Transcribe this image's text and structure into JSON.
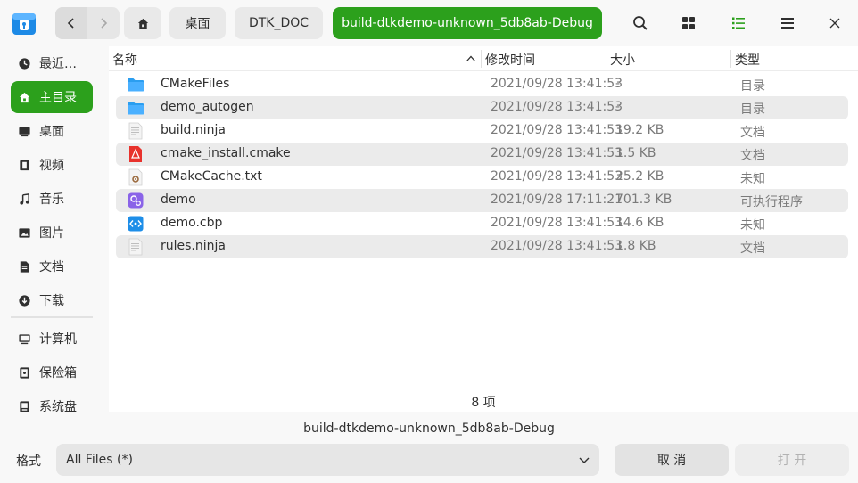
{
  "toolbar": {
    "breadcrumbs": [
      "桌面",
      "DTK_DOC",
      "build-dtkdemo-unknown_5db8ab-Debug"
    ]
  },
  "sidebar": {
    "items": [
      {
        "label": "最近…",
        "icon": "clock-icon"
      },
      {
        "label": "主目录",
        "icon": "home-icon",
        "active": true
      },
      {
        "label": "桌面",
        "icon": "desktop-icon"
      },
      {
        "label": "视频",
        "icon": "film-icon"
      },
      {
        "label": "音乐",
        "icon": "music-icon"
      },
      {
        "label": "图片",
        "icon": "picture-icon"
      },
      {
        "label": "文档",
        "icon": "document-icon"
      },
      {
        "label": "下载",
        "icon": "download-icon"
      },
      {
        "label": "计算机",
        "icon": "computer-icon"
      },
      {
        "label": "保险箱",
        "icon": "safe-icon"
      },
      {
        "label": "系统盘",
        "icon": "disk-icon"
      }
    ]
  },
  "columns": {
    "name": "名称",
    "mtime": "修改时间",
    "size": "大小",
    "type": "类型"
  },
  "files": [
    {
      "name": "CMakeFiles",
      "mtime": "2021/09/28 13:41:53",
      "size": "-",
      "type": "目录",
      "icon": "folder-icon"
    },
    {
      "name": "demo_autogen",
      "mtime": "2021/09/28 13:41:53",
      "size": "-",
      "type": "目录",
      "icon": "folder-icon"
    },
    {
      "name": "build.ninja",
      "mtime": "2021/09/28 13:41:53",
      "size": "19.2 KB",
      "type": "文档",
      "icon": "text-file-icon"
    },
    {
      "name": "cmake_install.cmake",
      "mtime": "2021/09/28 13:41:53",
      "size": "1.5 KB",
      "type": "文档",
      "icon": "cmake-file-icon"
    },
    {
      "name": "CMakeCache.txt",
      "mtime": "2021/09/28 13:41:53",
      "size": "25.2 KB",
      "type": "未知",
      "icon": "config-file-icon"
    },
    {
      "name": "demo",
      "mtime": "2021/09/28 17:11:21",
      "size": "701.3 KB",
      "type": "可执行程序",
      "icon": "executable-icon"
    },
    {
      "name": "demo.cbp",
      "mtime": "2021/09/28 13:41:53",
      "size": "14.6 KB",
      "type": "未知",
      "icon": "code-file-icon"
    },
    {
      "name": "rules.ninja",
      "mtime": "2021/09/28 13:41:53",
      "size": "1.8 KB",
      "type": "文档",
      "icon": "text-file-icon"
    }
  ],
  "item_count": "8 项",
  "current_dir": "build-dtkdemo-unknown_5db8ab-Debug",
  "format": {
    "label": "格式",
    "value": "All Files (*)"
  },
  "buttons": {
    "cancel": "取 消",
    "open": "打 开"
  },
  "colors": {
    "accent": "#2ca01c",
    "folder": "#2b9ef0"
  }
}
